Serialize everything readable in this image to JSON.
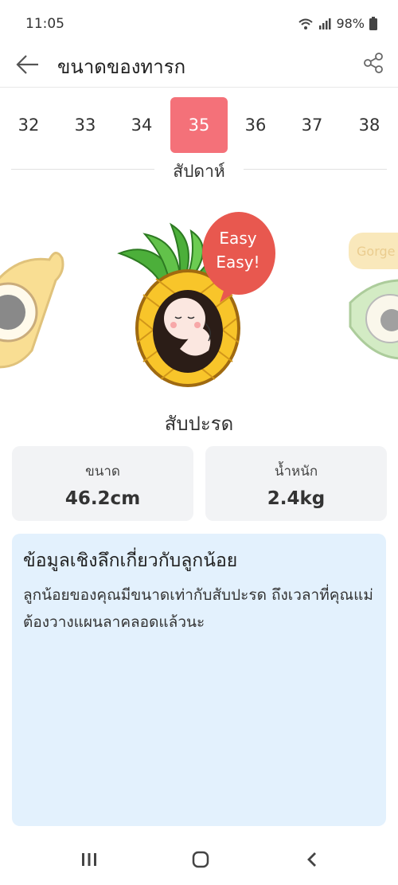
{
  "status": {
    "time": "11:05",
    "battery": "98%"
  },
  "header": {
    "title": "ขนาดของทารก"
  },
  "weeks": {
    "items": [
      "32",
      "33",
      "34",
      "35",
      "36",
      "37",
      "38"
    ],
    "selected": "35",
    "caption": "สัปดาห์"
  },
  "illustration": {
    "bubble_line1": "Easy",
    "bubble_line2": "Easy!",
    "side_label": "Gorge"
  },
  "fruit": {
    "name": "สับปะรด"
  },
  "stats": {
    "size_label": "ขนาด",
    "size_value": "46.2cm",
    "weight_label": "น้ำหนัก",
    "weight_value": "2.4kg"
  },
  "info": {
    "title": "ข้อมูลเชิงลึกเกี่ยวกับลูกน้อย",
    "body": "ลูกน้อยของคุณมีขนาดเท่ากับสับปะรด ถึงเวลาที่คุณแม่ต้องวางแผนลาคลอดแล้วนะ"
  },
  "colors": {
    "accent": "#f47179",
    "info_bg": "#e3f1fd",
    "card_bg": "#f2f3f5"
  },
  "icons": [
    "back-arrow-icon",
    "share-icon",
    "wifi-icon",
    "signal-icon",
    "battery-icon",
    "recents-icon",
    "home-icon",
    "nav-back-icon"
  ]
}
